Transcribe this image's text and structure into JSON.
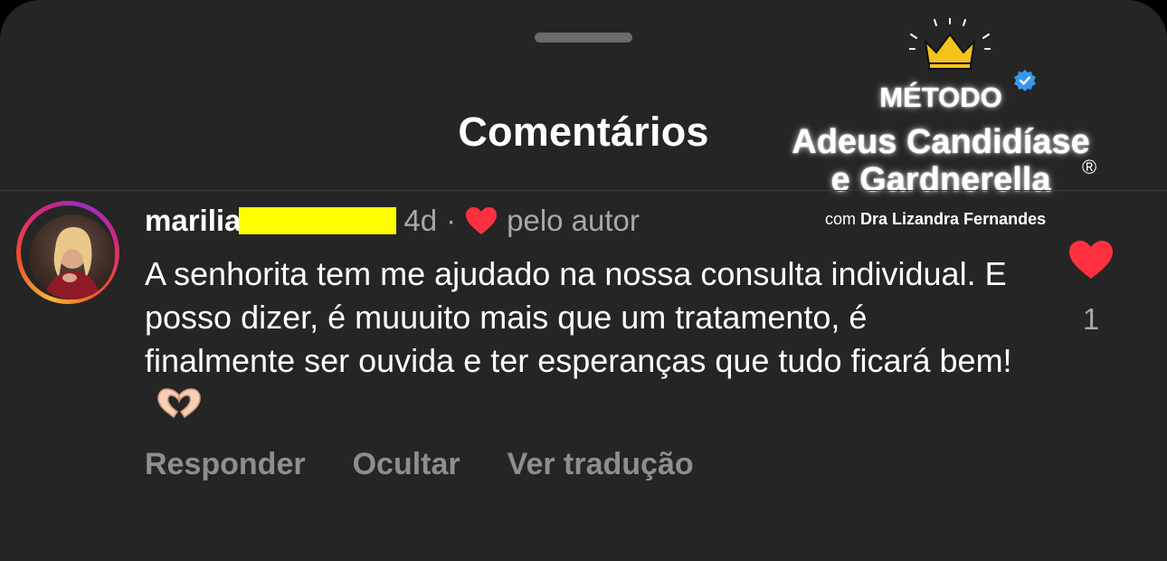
{
  "sheet": {
    "title": "Comentários"
  },
  "watermark": {
    "line1": "MÉTODO",
    "line2": "Adeus Candidíase",
    "line3": "e Gardnerella",
    "registered": "®",
    "credit_prefix": "com",
    "credit_name": "Dra Lizandra Fernandes"
  },
  "comment": {
    "username": "marilia",
    "time": "4d",
    "separator": "·",
    "liked_by_author": "pelo autor",
    "text": "A senhorita tem me ajudado na nossa consulta individual. E posso dizer, é muuuito mais que um tratamento, é finalmente ser ouvida e ter esperanças que tudo ficará bem!",
    "emoji": "heart-hands",
    "actions": {
      "reply": "Responder",
      "hide": "Ocultar",
      "translate": "Ver tradução"
    },
    "like_count": "1"
  },
  "colors": {
    "background": "#252525",
    "like_red": "#ff3040",
    "muted_text": "#a8a8a8",
    "redaction": "#ffff00"
  },
  "icons": [
    "verified-badge-icon",
    "crown-icon",
    "heart-icon",
    "heart-hands-emoji"
  ]
}
